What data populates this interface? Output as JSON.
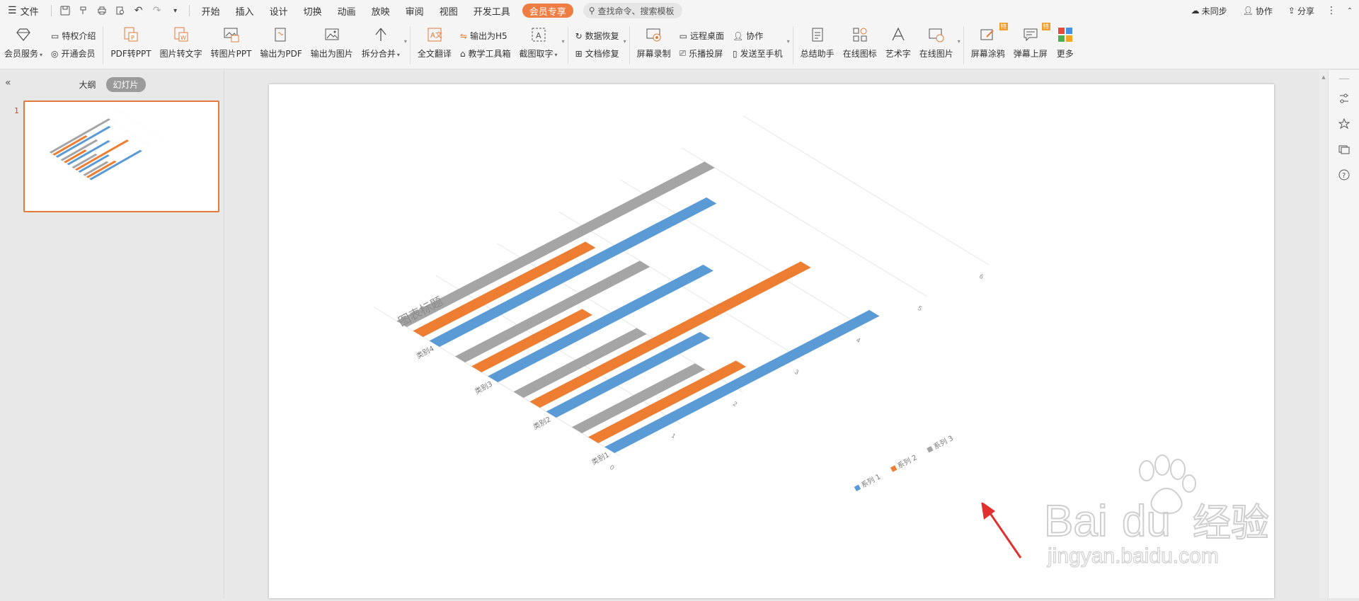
{
  "menubar": {
    "file_label": "文件",
    "tabs": [
      "开始",
      "插入",
      "设计",
      "切换",
      "动画",
      "放映",
      "审阅",
      "视图",
      "开发工具"
    ],
    "vip_tab": "会员专享",
    "search_placeholder": "查找命令、搜索模板",
    "right": {
      "sync": "未同步",
      "collab": "协作",
      "share": "分享"
    }
  },
  "ribbon": {
    "member_service": "会员服务",
    "privilege_intro": "特权介绍",
    "open_member": "开通会员",
    "pdf_to_ppt": "PDF转PPT",
    "image_to_text": "图片转文字",
    "to_image_ppt": "转图片PPT",
    "export_pdf": "输出为PDF",
    "export_image": "输出为图片",
    "split_merge": "拆分合并",
    "full_translate": "全文翻译",
    "export_h5": "输出为H5",
    "teaching_tools": "教学工具箱",
    "screenshot_ocr": "截图取字",
    "data_recovery": "数据恢复",
    "doc_repair": "文档修复",
    "screen_record": "屏幕录制",
    "remote_desktop": "远程桌面",
    "cast_screen": "乐播投屏",
    "collab": "协作",
    "send_to_phone": "发送至手机",
    "summary_assistant": "总结助手",
    "online_icons": "在线图标",
    "word_art": "艺术字",
    "online_images": "在线图片",
    "screen_doodle": "屏幕涂鸦",
    "danmaku": "弹幕上屏",
    "more": "更多",
    "badge_special": "特"
  },
  "left_panel": {
    "tab_outline": "大纲",
    "tab_slides": "幻灯片",
    "slide_number": "1"
  },
  "colors": {
    "accent": "#ee7d44",
    "series1": "#5b9bd5",
    "series2": "#ed7d31",
    "series3": "#a5a5a5",
    "selection_border": "#e07b3c"
  },
  "chart_data": {
    "type": "bar",
    "title": "图表标题",
    "categories": [
      "类别1",
      "类别2",
      "类别3",
      "类别4"
    ],
    "series": [
      {
        "name": "系列 1",
        "values": [
          4.3,
          2.5,
          3.5,
          4.5
        ]
      },
      {
        "name": "系列 2",
        "values": [
          2.4,
          4.4,
          1.8,
          2.8
        ]
      },
      {
        "name": "系列 3",
        "values": [
          2.0,
          2.0,
          3.0,
          5.0
        ]
      }
    ],
    "y_ticks": [
      "0",
      "1",
      "2",
      "3",
      "4",
      "5",
      "6"
    ],
    "ylim": [
      0,
      6
    ],
    "grid": true,
    "legend_position": "bottom"
  },
  "watermark": {
    "brand": "Bai",
    "brand2": "du",
    "brand_cn": "经验",
    "url": "jingyan.baidu.com"
  }
}
